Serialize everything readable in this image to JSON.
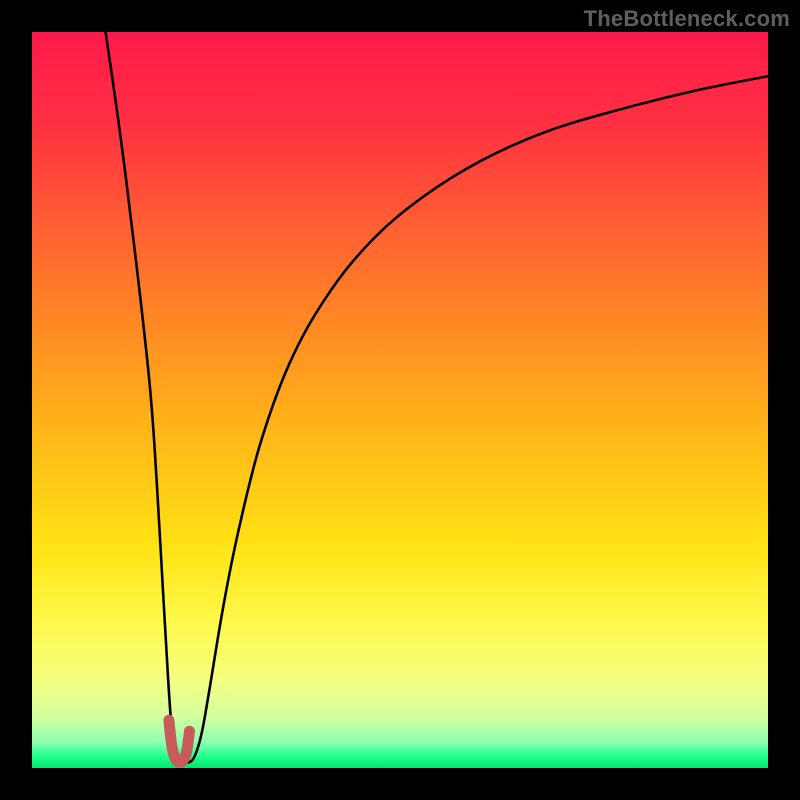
{
  "watermark": "TheBottleneck.com",
  "gradient_stops": [
    {
      "offset": 0.0,
      "color": "#ff1a4b"
    },
    {
      "offset": 0.12,
      "color": "#ff2f42"
    },
    {
      "offset": 0.25,
      "color": "#ff5a34"
    },
    {
      "offset": 0.4,
      "color": "#ff8a24"
    },
    {
      "offset": 0.55,
      "color": "#ffb818"
    },
    {
      "offset": 0.7,
      "color": "#ffe314"
    },
    {
      "offset": 0.8,
      "color": "#fff94a"
    },
    {
      "offset": 0.88,
      "color": "#f4ff80"
    },
    {
      "offset": 0.93,
      "color": "#d4ffa0"
    },
    {
      "offset": 0.965,
      "color": "#8effb0"
    },
    {
      "offset": 0.985,
      "color": "#1eff8a"
    },
    {
      "offset": 1.0,
      "color": "#00e56a"
    }
  ],
  "chart_data": {
    "type": "line",
    "title": "",
    "xlabel": "",
    "ylabel": "",
    "xlim": [
      0,
      100
    ],
    "ylim": [
      0,
      100
    ],
    "series": [
      {
        "name": "bottleneck-curve",
        "x": [
          10,
          12,
          14,
          16,
          17,
          17.8,
          18.5,
          19,
          19.5,
          20,
          21,
          22,
          23,
          24,
          26,
          28,
          31,
          35,
          40,
          46,
          53,
          61,
          70,
          80,
          90,
          100
        ],
        "values": [
          100,
          86,
          70,
          52,
          38,
          24,
          12,
          5,
          1.2,
          0.7,
          0.7,
          1.4,
          4.5,
          10,
          22,
          32,
          44,
          55,
          64,
          71.5,
          77.5,
          82.5,
          86.5,
          89.5,
          92,
          94
        ]
      },
      {
        "name": "optimal-marker",
        "x": [
          18.6,
          19.0,
          19.5,
          20.0,
          20.5,
          21.0,
          21.4
        ],
        "values": [
          6.5,
          3.0,
          1.2,
          0.8,
          1.0,
          2.2,
          5.0
        ]
      }
    ],
    "optimal_x": 20,
    "annotations": []
  }
}
